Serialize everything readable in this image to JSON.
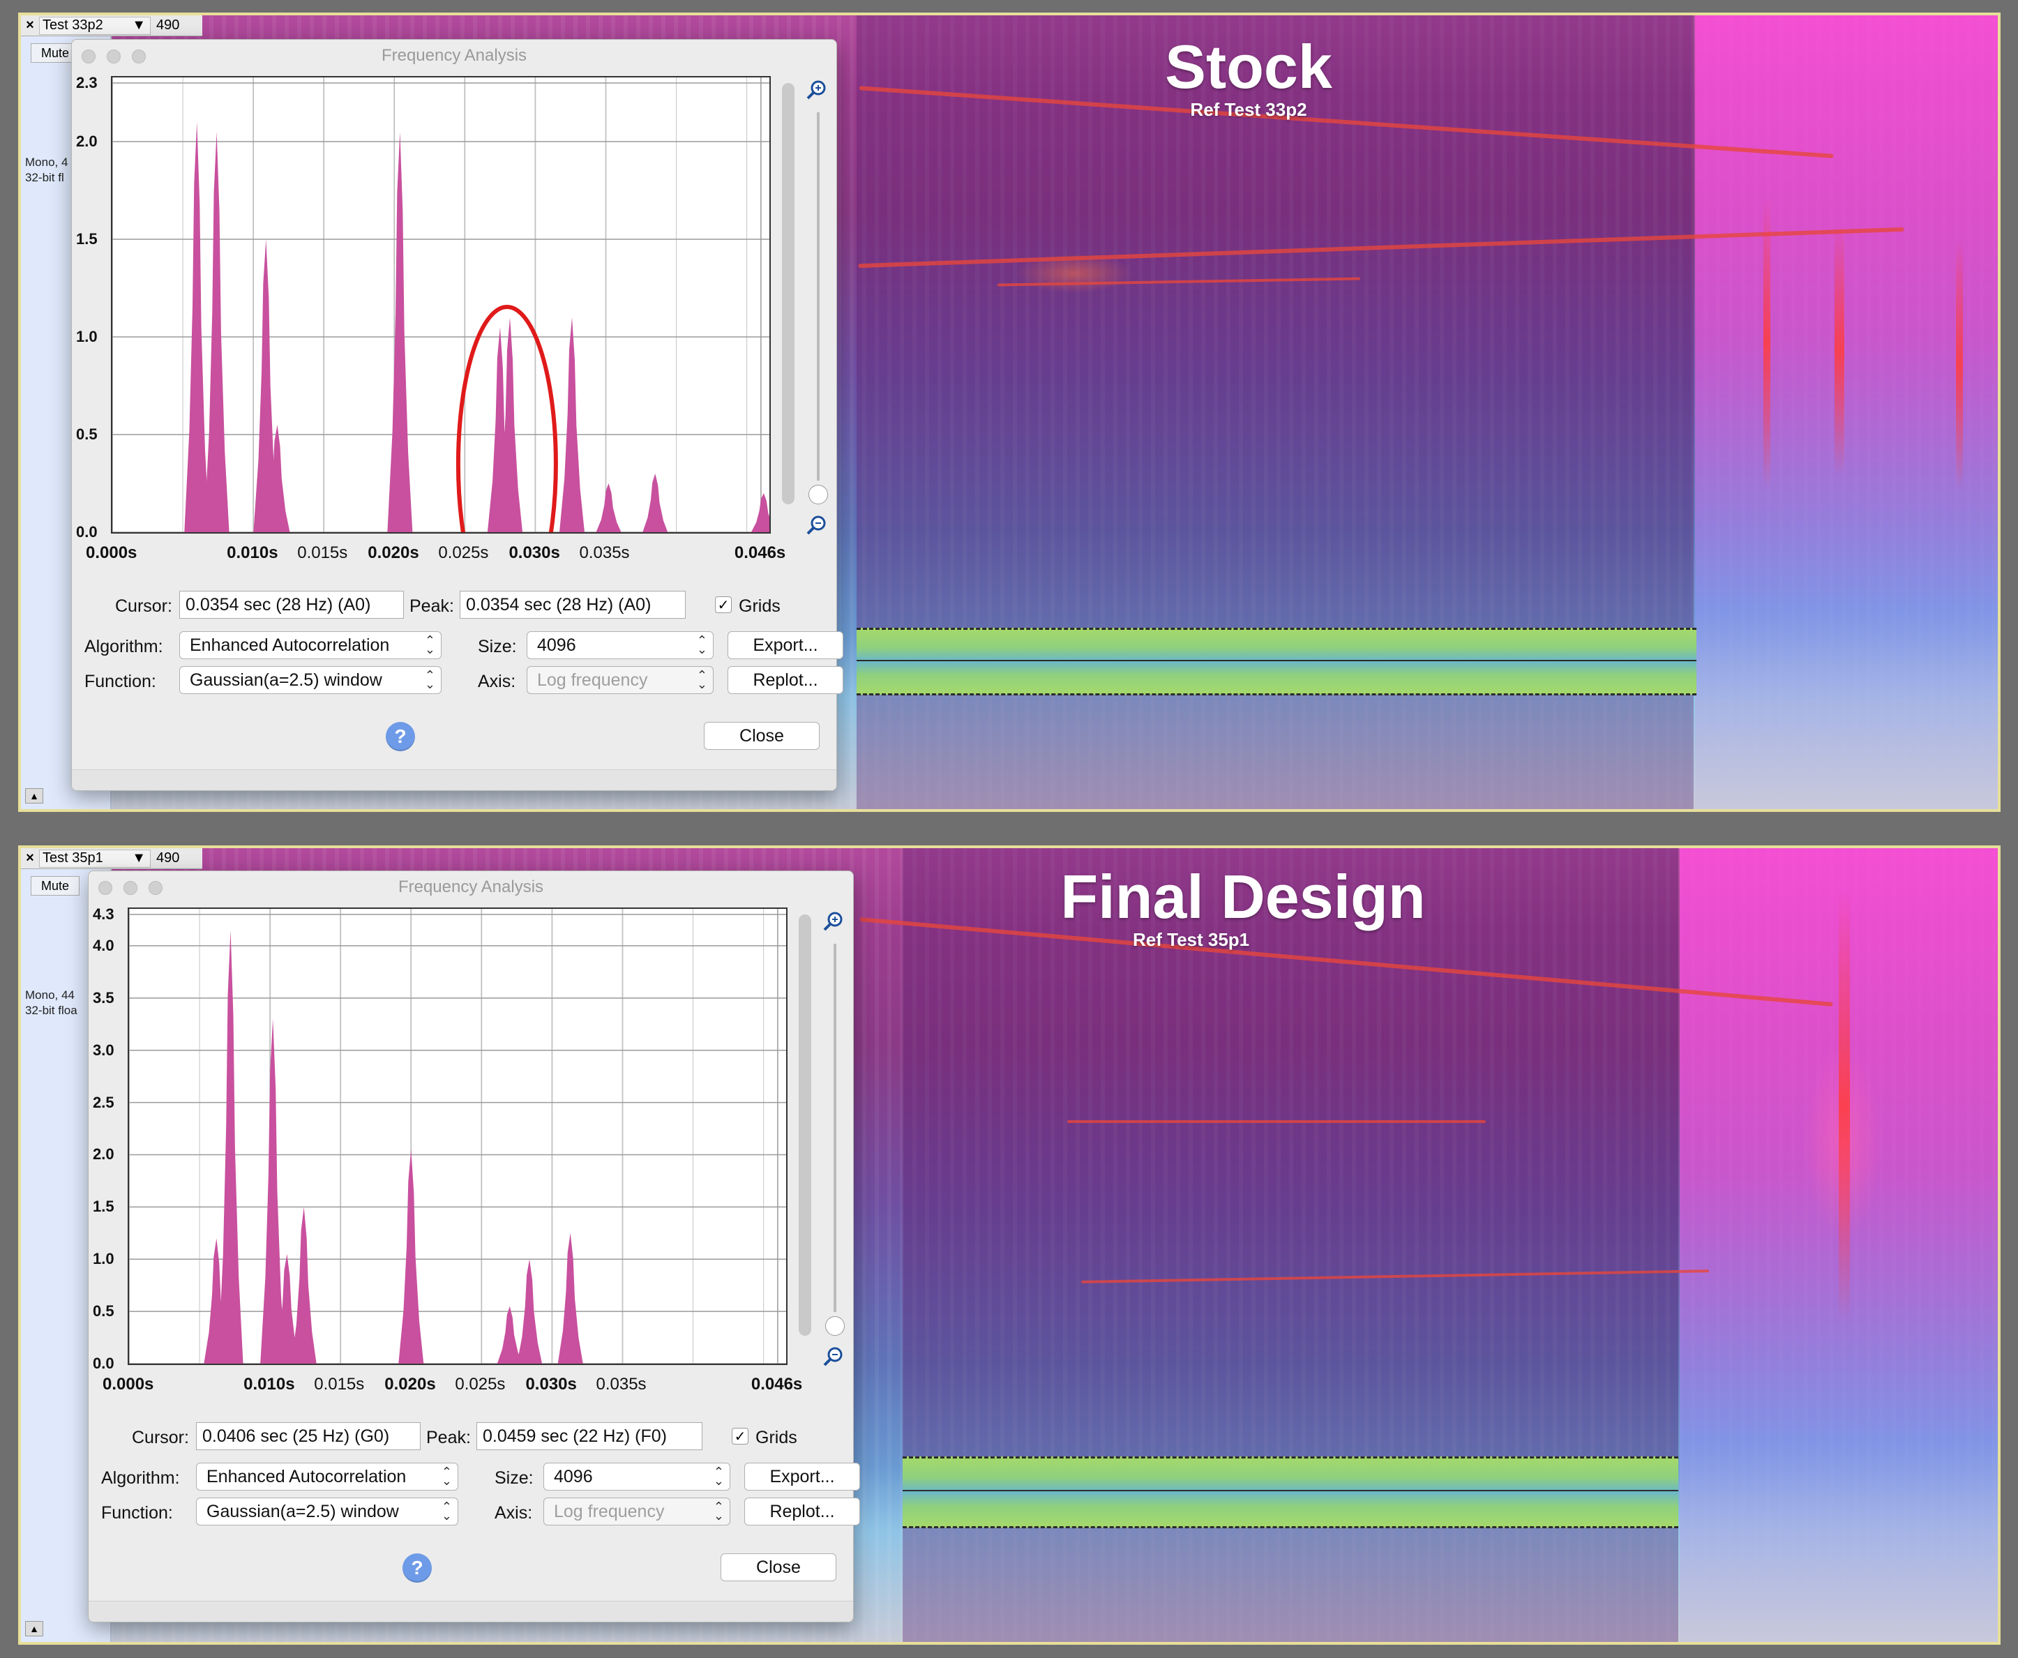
{
  "panels": [
    {
      "overlay_title": "Stock",
      "overlay_subtitle": "Ref Test 33p2",
      "track": {
        "close": "×",
        "name": "Test 33p2",
        "number": "490",
        "mute": "Mute",
        "info_line1": "Mono, 4",
        "info_line2": "32-bit fl"
      },
      "dialog": {
        "title": "Frequency Analysis",
        "cursor_label": "Cursor:",
        "cursor_value": "0.0354 sec (28 Hz) (A0)",
        "peak_label": "Peak:",
        "peak_value": "0.0354 sec (28 Hz) (A0)",
        "grids_label": "Grids",
        "grids_checked": true,
        "algorithm_label": "Algorithm:",
        "algorithm_value": "Enhanced Autocorrelation",
        "size_label": "Size:",
        "size_value": "4096",
        "export_label": "Export...",
        "function_label": "Function:",
        "function_value": "Gaussian(a=2.5) window",
        "axis_label": "Axis:",
        "axis_value": "Log frequency",
        "replot_label": "Replot...",
        "help_label": "?",
        "close_label": "Close"
      },
      "chart_data": {
        "type": "area",
        "x_unit": "s",
        "xlim": [
          0.0,
          0.0466
        ],
        "ylim": [
          0.0,
          2.3
        ],
        "y_ticks": [
          "2.3",
          "2.0",
          "1.5",
          "1.0",
          "0.5",
          "0.0"
        ],
        "x_ticks": [
          "0.000s",
          "0.010s",
          "0.015s",
          "0.020s",
          "0.025s",
          "0.030s",
          "0.035s",
          "0.046s"
        ],
        "x_ticks_bold": [
          true,
          true,
          false,
          true,
          false,
          true,
          false,
          true
        ],
        "peaks": [
          {
            "x": 0.006,
            "y": 2.1
          },
          {
            "x": 0.0074,
            "y": 2.05
          },
          {
            "x": 0.0109,
            "y": 1.5
          },
          {
            "x": 0.0117,
            "y": 0.55
          },
          {
            "x": 0.0204,
            "y": 2.05
          },
          {
            "x": 0.0275,
            "y": 1.05
          },
          {
            "x": 0.0282,
            "y": 1.1
          },
          {
            "x": 0.0326,
            "y": 1.1
          },
          {
            "x": 0.0352,
            "y": 0.25
          },
          {
            "x": 0.0385,
            "y": 0.3
          },
          {
            "x": 0.0462,
            "y": 0.2
          }
        ],
        "annotation": "red ellipse around peak near 0.0275s"
      }
    },
    {
      "overlay_title": "Final Design",
      "overlay_subtitle": "Ref Test 35p1",
      "track": {
        "close": "×",
        "name": "Test 35p1",
        "number": "490",
        "mute": "Mute",
        "info_line1": "Mono, 44",
        "info_line2": "32-bit floa"
      },
      "dialog": {
        "title": "Frequency Analysis",
        "cursor_label": "Cursor:",
        "cursor_value": "0.0406 sec (25 Hz) (G0)",
        "peak_label": "Peak:",
        "peak_value": "0.0459 sec (22 Hz) (F0)",
        "grids_label": "Grids",
        "grids_checked": true,
        "algorithm_label": "Algorithm:",
        "algorithm_value": "Enhanced Autocorrelation",
        "size_label": "Size:",
        "size_value": "4096",
        "export_label": "Export...",
        "function_label": "Function:",
        "function_value": "Gaussian(a=2.5) window",
        "axis_label": "Axis:",
        "axis_value": "Log frequency",
        "replot_label": "Replot...",
        "help_label": "?",
        "close_label": "Close"
      },
      "chart_data": {
        "type": "area",
        "x_unit": "s",
        "xlim": [
          0.0,
          0.0466
        ],
        "ylim": [
          0.0,
          4.3
        ],
        "y_ticks": [
          "4.3",
          "4.0",
          "3.5",
          "3.0",
          "2.5",
          "2.0",
          "1.5",
          "1.0",
          "0.5",
          "0.0"
        ],
        "x_ticks": [
          "0.000s",
          "0.010s",
          "0.015s",
          "0.020s",
          "0.025s",
          "0.030s",
          "0.035s",
          "0.046s"
        ],
        "x_ticks_bold": [
          true,
          true,
          false,
          true,
          false,
          true,
          false,
          true
        ],
        "peaks": [
          {
            "x": 0.0062,
            "y": 1.2
          },
          {
            "x": 0.0072,
            "y": 4.15
          },
          {
            "x": 0.0102,
            "y": 3.3
          },
          {
            "x": 0.0112,
            "y": 1.05
          },
          {
            "x": 0.0124,
            "y": 1.5
          },
          {
            "x": 0.02,
            "y": 2.05
          },
          {
            "x": 0.027,
            "y": 0.55
          },
          {
            "x": 0.0284,
            "y": 1.0
          },
          {
            "x": 0.0313,
            "y": 1.25
          }
        ]
      }
    }
  ]
}
